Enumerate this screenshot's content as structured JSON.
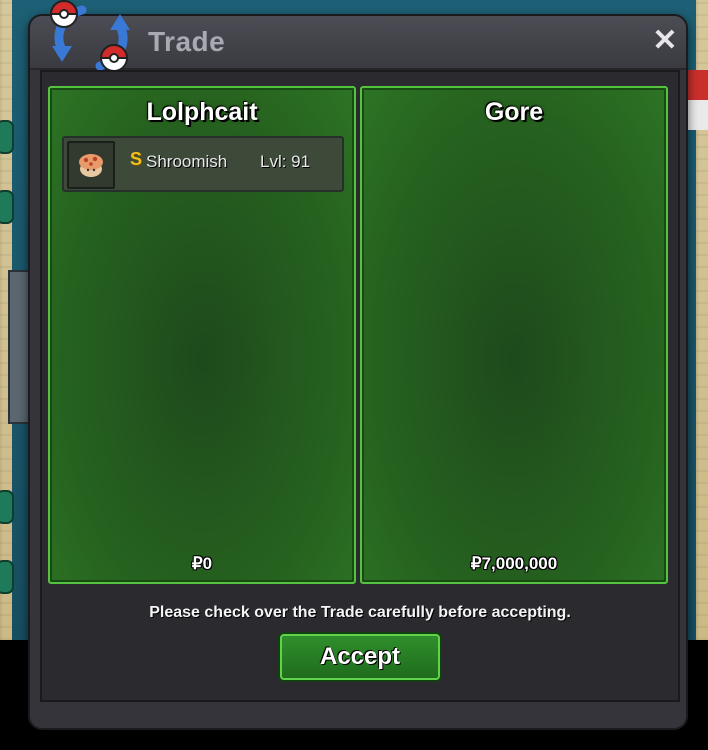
{
  "window": {
    "title": "Trade",
    "close_glyph": "✕"
  },
  "trade": {
    "left": {
      "player": "Lolphcait",
      "money": "₽0",
      "items": [
        {
          "badge": "S",
          "name": "Shroomish",
          "level": "Lvl: 91",
          "icon": "shroomish-sprite-icon"
        }
      ]
    },
    "right": {
      "player": "Gore",
      "money": "₽7,000,000",
      "items": []
    },
    "notice": "Please check over the Trade carefully before accepting.",
    "accept_label": "Accept"
  },
  "colors": {
    "panel_border": "#56c340",
    "panel_fill": "#26621f",
    "shiny_badge": "#f2c21b",
    "dialog_bg": "#34343a"
  }
}
